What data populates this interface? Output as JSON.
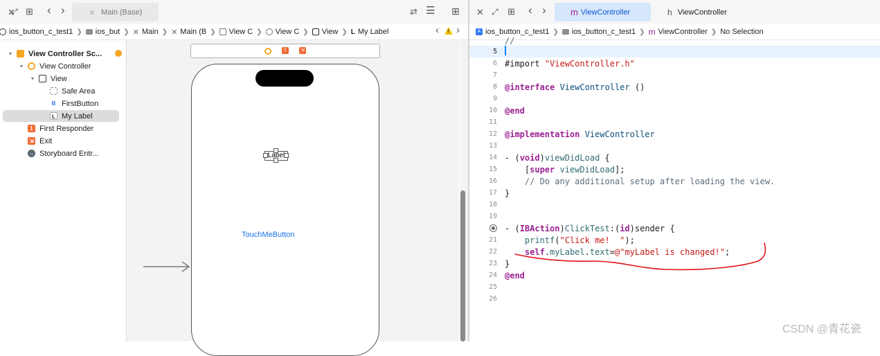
{
  "left_toolbar": {
    "tab_label": "Main (Base)"
  },
  "ib_breadcrumb": [
    "ios_button_c_test1",
    "ios_but",
    "Main",
    "Main (B",
    "View C",
    "View C",
    "View",
    "My Label"
  ],
  "outline": {
    "items": [
      {
        "label": "View Controller Sc...",
        "icon": "scene-icon",
        "color": "#f5a623",
        "level": 0,
        "expanded": true,
        "bold": true,
        "selected": false
      },
      {
        "label": "View Controller",
        "icon": "view-controller-icon",
        "color": "#f5a623",
        "level": 1,
        "expanded": true,
        "bold": false,
        "selected": false
      },
      {
        "label": "View",
        "icon": "view-icon",
        "color": "#3a3a3c",
        "level": 2,
        "expanded": true,
        "bold": false,
        "selected": false
      },
      {
        "label": "Safe Area",
        "icon": "safe-area-icon",
        "color": "#8e8e93",
        "level": 3,
        "bold": false,
        "selected": false
      },
      {
        "label": "FirstButton",
        "icon": "button-icon",
        "color": "#3478f6",
        "level": 3,
        "bold": false,
        "selected": false
      },
      {
        "label": "My Label",
        "icon": "label-icon",
        "color": "#1d1d1f",
        "level": 3,
        "bold": false,
        "selected": true
      },
      {
        "label": "First Responder",
        "icon": "first-responder-icon",
        "color": "#f06a35",
        "level": 1,
        "bold": false,
        "selected": false
      },
      {
        "label": "Exit",
        "icon": "exit-icon",
        "color": "#f06a35",
        "level": 1,
        "bold": false,
        "selected": false
      },
      {
        "label": "Storyboard Entr...",
        "icon": "storyboard-entry-icon",
        "color": "#5a6570",
        "level": 1,
        "bold": false,
        "selected": false
      }
    ]
  },
  "canvas": {
    "label_text": "Label",
    "button_text": "TouchMeButton"
  },
  "editor_tabs": [
    {
      "prefix": "m",
      "label": "ViewController",
      "active": true
    },
    {
      "prefix": "h",
      "label": "ViewController",
      "active": false
    }
  ],
  "editor_breadcrumb": [
    "ios_button_c_test1",
    "ios_button_c_test1",
    "ViewController",
    "No Selection"
  ],
  "code_lines": [
    {
      "n": "",
      "html": "<span class=\"cm\">//</span>",
      "partial": true
    },
    {
      "n": "5",
      "html": "",
      "current": true
    },
    {
      "n": "6",
      "html": "#import <span class=\"str\">\"ViewController.h\"</span>"
    },
    {
      "n": "7",
      "html": ""
    },
    {
      "n": "8",
      "html": "<span class=\"kw\">@interface</span> <span class=\"cls\">ViewController</span> ()"
    },
    {
      "n": "9",
      "html": ""
    },
    {
      "n": "10",
      "html": "<span class=\"kw\">@end</span>"
    },
    {
      "n": "11",
      "html": ""
    },
    {
      "n": "12",
      "html": "<span class=\"kw\">@implementation</span> <span class=\"cls\">ViewController</span>"
    },
    {
      "n": "13",
      "html": ""
    },
    {
      "n": "14",
      "html": "- (<span class=\"kw\">void</span>)<span class=\"fn\">viewDidLoad</span> {"
    },
    {
      "n": "15",
      "html": "    [<span class=\"kw\">super</span> <span class=\"fn\">viewDidLoad</span>];"
    },
    {
      "n": "16",
      "html": "    <span class=\"cm\">// Do any additional setup after loading the view.</span>"
    },
    {
      "n": "17",
      "html": "}"
    },
    {
      "n": "18",
      "html": ""
    },
    {
      "n": "19",
      "html": ""
    },
    {
      "n": "",
      "html": "- (<span class=\"kw\">IBAction</span>)<span class=\"fn\">ClickTest</span>:(<span class=\"kw\">id</span>)sender {",
      "breakpoint": true
    },
    {
      "n": "21",
      "html": "    <span class=\"fn\">printf</span>(<span class=\"str\">\"Click me!  \"</span>);"
    },
    {
      "n": "22",
      "html": "    <span class=\"kw\">self</span>.<span class=\"fn\">myLabel</span>.<span class=\"fn\">text</span>=<span class=\"str\">@\"myLabel is changed!\"</span>;"
    },
    {
      "n": "23",
      "html": "}"
    },
    {
      "n": "24",
      "html": "<span class=\"kw\">@end</span>"
    },
    {
      "n": "25",
      "html": ""
    },
    {
      "n": "26",
      "html": ""
    }
  ],
  "watermark": "CSDN @青花瓷",
  "colors": {
    "accent": "#0a84ff",
    "selection": "#dcdcdc",
    "annotation_red": "#e0141a",
    "active_tab": "#d6e6fb"
  }
}
